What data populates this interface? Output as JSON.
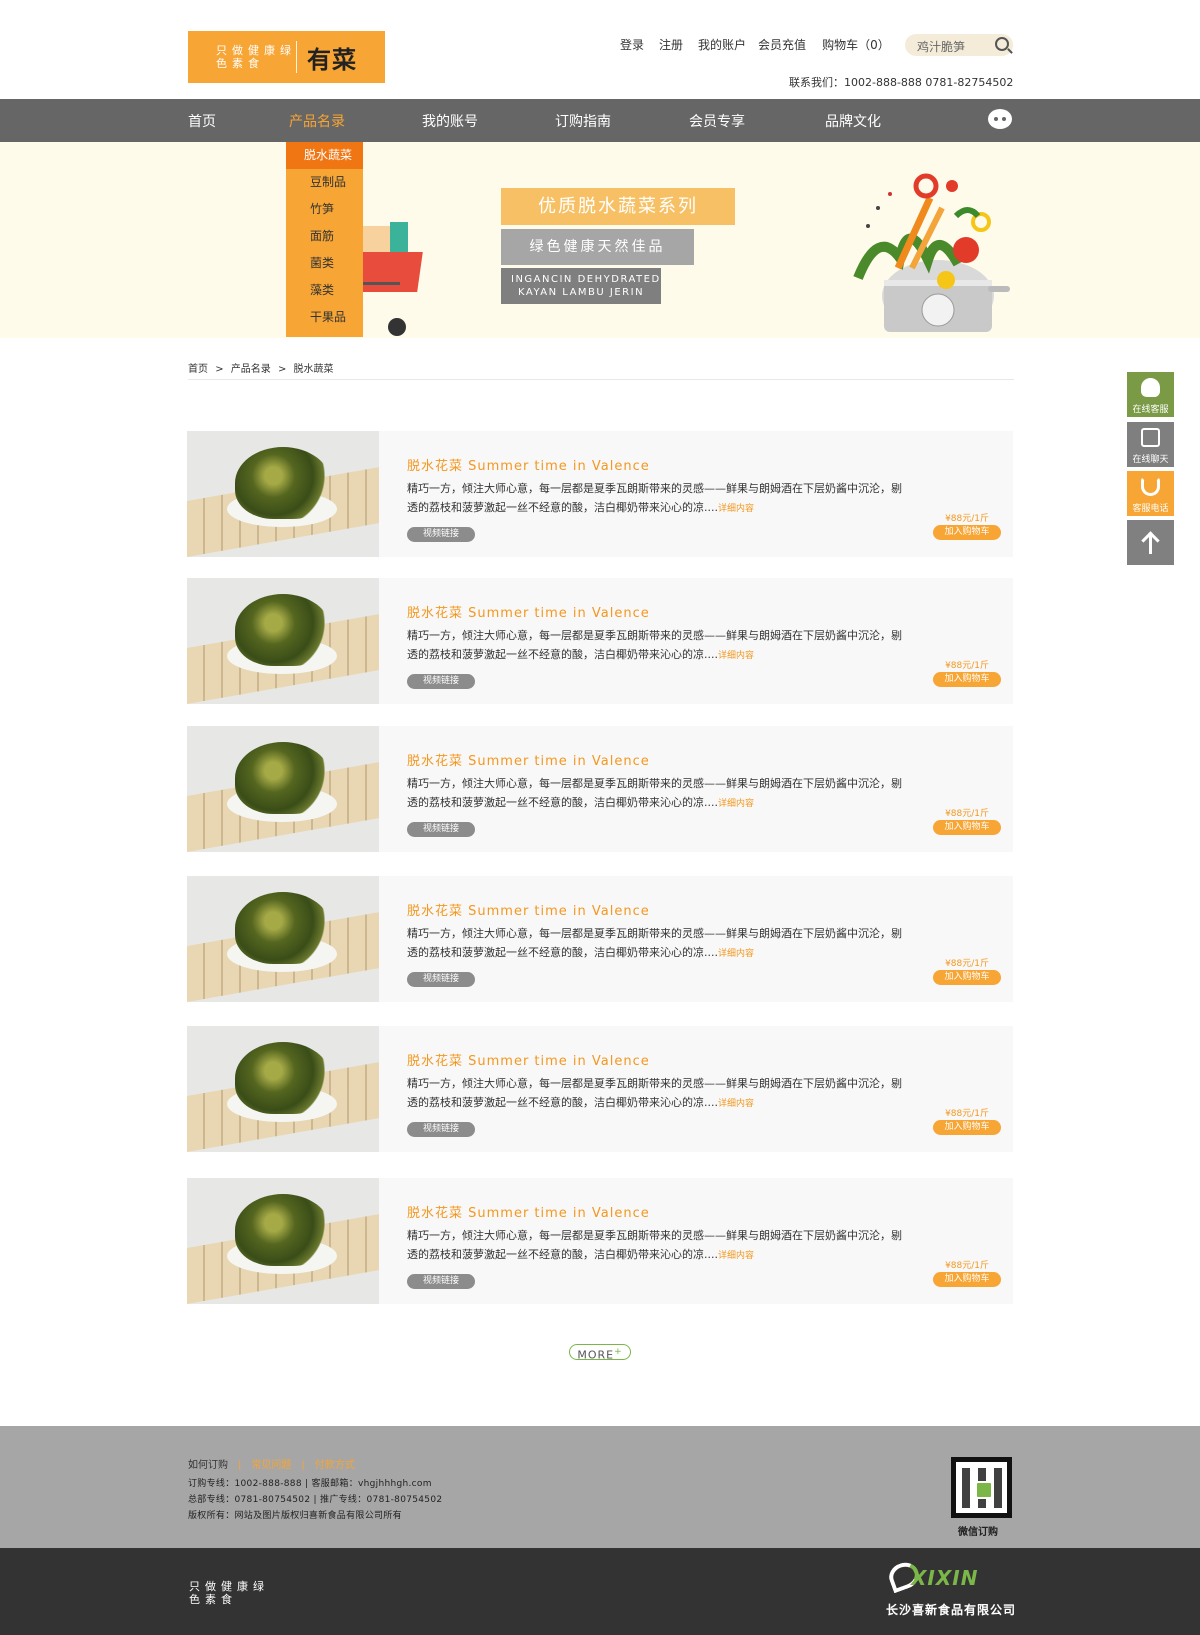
{
  "header": {
    "logo_slogan": "只做健康绿色素食",
    "logo_name": "有菜",
    "links": [
      "登录",
      "注册",
      "我的账户",
      "会员充值",
      "购物车（0）"
    ],
    "search_placeholder": "鸡汁脆笋",
    "contact": "联系我们：1002-888-888   0781-82754502"
  },
  "nav": {
    "items": [
      "首页",
      "产品名录",
      "我的账号",
      "订购指南",
      "会员专享",
      "品牌文化"
    ],
    "active": "产品名录"
  },
  "dropdown": [
    "脱水蔬菜",
    "豆制品",
    "竹笋",
    "面筋",
    "菌类",
    "藻类",
    "干果品"
  ],
  "banner": {
    "title": "优质脱水蔬菜系列",
    "subtitle": "绿色健康天然佳品",
    "english_line1": "INGANCIN DEHYDRATED",
    "english_line2": "KAYAN LAMBU JERIN"
  },
  "breadcrumb": [
    "首页",
    ">",
    "产品名录",
    ">",
    "脱水蔬菜"
  ],
  "products": [
    {
      "title": "脱水花菜 Summer time in Valence",
      "desc": "精巧一方，倾注大师心意，每一层都是夏季瓦朗斯带来的灵感——鲜果与朗姆酒在下层奶酱中沉沦，剔透的荔枝和菠萝激起一丝不经意的酸，洁白椰奶带来沁心的凉....",
      "more": "详细内容",
      "video": "视频链接",
      "price": "¥88元/1斤",
      "cart": "加入购物车"
    },
    {
      "title": "脱水花菜 Summer time in Valence",
      "desc": "精巧一方，倾注大师心意，每一层都是夏季瓦朗斯带来的灵感——鲜果与朗姆酒在下层奶酱中沉沦，剔透的荔枝和菠萝激起一丝不经意的酸，洁白椰奶带来沁心的凉....",
      "more": "详细内容",
      "video": "视频链接",
      "price": "¥88元/1斤",
      "cart": "加入购物车"
    },
    {
      "title": "脱水花菜 Summer time in Valence",
      "desc": "精巧一方，倾注大师心意，每一层都是夏季瓦朗斯带来的灵感——鲜果与朗姆酒在下层奶酱中沉沦，剔透的荔枝和菠萝激起一丝不经意的酸，洁白椰奶带来沁心的凉....",
      "more": "详细内容",
      "video": "视频链接",
      "price": "¥88元/1斤",
      "cart": "加入购物车"
    },
    {
      "title": "脱水花菜 Summer time in Valence",
      "desc": "精巧一方，倾注大师心意，每一层都是夏季瓦朗斯带来的灵感——鲜果与朗姆酒在下层奶酱中沉沦，剔透的荔枝和菠萝激起一丝不经意的酸，洁白椰奶带来沁心的凉....",
      "more": "详细内容",
      "video": "视频链接",
      "price": "¥88元/1斤",
      "cart": "加入购物车"
    },
    {
      "title": "脱水花菜 Summer time in Valence",
      "desc": "精巧一方，倾注大师心意，每一层都是夏季瓦朗斯带来的灵感——鲜果与朗姆酒在下层奶酱中沉沦，剔透的荔枝和菠萝激起一丝不经意的酸，洁白椰奶带来沁心的凉....",
      "more": "详细内容",
      "video": "视频链接",
      "price": "¥88元/1斤",
      "cart": "加入购物车"
    },
    {
      "title": "脱水花菜 Summer time in Valence",
      "desc": "精巧一方，倾注大师心意，每一层都是夏季瓦朗斯带来的灵感——鲜果与朗姆酒在下层奶酱中沉沦，剔透的荔枝和菠萝激起一丝不经意的酸，洁白椰奶带来沁心的凉....",
      "more": "详细内容",
      "video": "视频链接",
      "price": "¥88元/1斤",
      "cart": "加入购物车"
    }
  ],
  "more_button": "MORE",
  "more_plus": "+",
  "side": {
    "qq": "在线客服",
    "chat": "在线聊天",
    "tel": "客服电话"
  },
  "footer": {
    "links": [
      "如何订购",
      "常见问题",
      "付款方式"
    ],
    "line1": "订购专线：1002-888-888  |  客服邮箱：vhgjhhhgh.com",
    "line2": "总部专线：0781-80754502  |  推广专线：0781-80754502",
    "line3": "版权所有：网站及图片版权归喜新食品有限公司所有",
    "qr_label": "微信订购",
    "slogan": "只做健康绿色素食",
    "brand": "XIXIN",
    "company": "长沙喜新食品有限公司"
  },
  "colors": {
    "accent": "#f7a534",
    "nav": "#666666",
    "green": "#7ab648",
    "footer_light": "#a6a6a6",
    "footer_dark": "#333333"
  }
}
